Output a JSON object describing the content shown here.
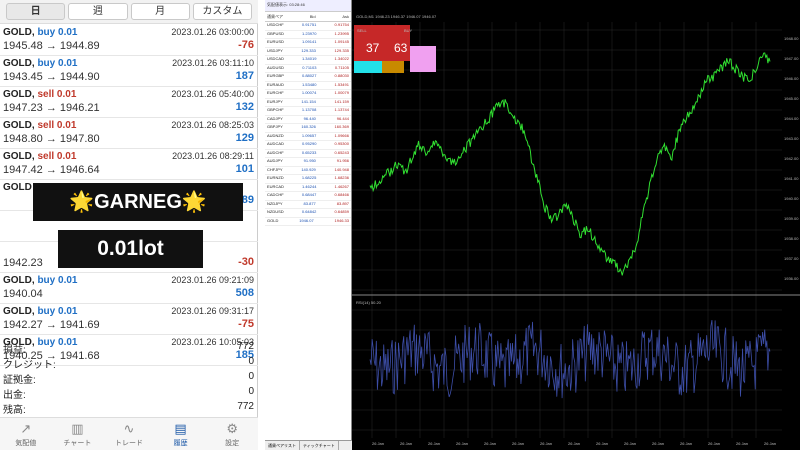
{
  "tabs": [
    "日",
    "週",
    "月",
    "カスタム"
  ],
  "trades": [
    {
      "symbol": "GOLD",
      "side": "buy",
      "lot": "0.01",
      "time": "2023.01.26 03:00:00",
      "from": "1945.48",
      "to": "1944.89",
      "profit": "-76"
    },
    {
      "symbol": "GOLD",
      "side": "buy",
      "lot": "0.01",
      "time": "2023.01.26 03:11:10",
      "from": "1943.45",
      "to": "1944.90",
      "profit": "187"
    },
    {
      "symbol": "GOLD",
      "side": "sell",
      "lot": "0.01",
      "time": "2023.01.26 05:40:00",
      "from": "1947.23",
      "to": "1946.21",
      "profit": "132"
    },
    {
      "symbol": "GOLD",
      "side": "sell",
      "lot": "0.01",
      "time": "2023.01.26 08:25:03",
      "from": "1948.80",
      "to": "1947.80",
      "profit": "129"
    },
    {
      "symbol": "GOLD",
      "side": "sell",
      "lot": "0.01",
      "time": "2023.01.26 08:29:11",
      "from": "1947.42",
      "to": "1946.64",
      "profit": "101"
    },
    {
      "symbol": "GOLD",
      "side": "",
      "lot": "",
      "time": "",
      "from": "",
      "to": "",
      "profit": "289"
    },
    {
      "symbol": "",
      "side": "",
      "lot": "",
      "time": "",
      "from": "",
      "to": "",
      "profit": ""
    },
    {
      "symbol": "",
      "side": "",
      "lot": "",
      "time": "",
      "from": "1942.23",
      "to": "",
      "profit": "-30"
    },
    {
      "symbol": "GOLD",
      "side": "buy",
      "lot": "0.01",
      "time": "2023.01.26 09:21:09",
      "from": "1940.04",
      "to": "",
      "profit": "508"
    },
    {
      "symbol": "GOLD",
      "side": "buy",
      "lot": "0.01",
      "time": "2023.01.26 09:31:17",
      "from": "1942.27",
      "to": "1941.69",
      "profit": "-75"
    },
    {
      "symbol": "GOLD",
      "side": "buy",
      "lot": "0.01",
      "time": "2023.01.26 10:05:03",
      "from": "1940.25",
      "to": "1941.68",
      "profit": "185"
    }
  ],
  "summary": [
    {
      "label": "損益:",
      "value": "772"
    },
    {
      "label": "クレジット:",
      "value": "0"
    },
    {
      "label": "証拠金:",
      "value": "0"
    },
    {
      "label": "出金:",
      "value": "0"
    },
    {
      "label": "残高:",
      "value": "772"
    }
  ],
  "nav": [
    {
      "label": "気配値",
      "icon": "↗"
    },
    {
      "label": "チャート",
      "icon": "▥"
    },
    {
      "label": "トレード",
      "icon": "∿"
    },
    {
      "label": "履歴",
      "icon": "▤"
    },
    {
      "label": "設定",
      "icon": "⚙"
    }
  ],
  "overlay": {
    "star": "🌟",
    "name": "GARNEG",
    "lot": "0.01lot"
  },
  "watch_rows": [
    {
      "sym": "USDCHF",
      "bid": "0.91751",
      "ask": "0.91754"
    },
    {
      "sym": "GBPUSD",
      "bid": "1.23970",
      "ask": "1.23995"
    },
    {
      "sym": "EURUSD",
      "bid": "1.09141",
      "ask": "1.09145"
    },
    {
      "sym": "USDJPY",
      "bid": "129.333",
      "ask": "129.335"
    },
    {
      "sym": "USDCAD",
      "bid": "1.34019",
      "ask": "1.34022"
    },
    {
      "sym": "AUDUSD",
      "bid": "0.71103",
      "ask": "0.71105"
    },
    {
      "sym": "EURGBP",
      "bid": "0.88027",
      "ask": "0.88030"
    },
    {
      "sym": "EURAUD",
      "bid": "1.53480",
      "ask": "1.53491"
    },
    {
      "sym": "EURCHF",
      "bid": "1.00074",
      "ask": "1.00079"
    },
    {
      "sym": "EURJPY",
      "bid": "141.154",
      "ask": "141.159"
    },
    {
      "sym": "GBPCHF",
      "bid": "1.13708",
      "ask": "1.13744"
    },
    {
      "sym": "CADJPY",
      "bid": "96.440",
      "ask": "96.444"
    },
    {
      "sym": "GBPJPY",
      "bid": "160.326",
      "ask": "160.369"
    },
    {
      "sym": "AUDNZD",
      "bid": "1.09657",
      "ask": "1.09666"
    },
    {
      "sym": "AUDCAD",
      "bid": "0.95290",
      "ask": "0.95300"
    },
    {
      "sym": "AUDCHF",
      "bid": "0.65233",
      "ask": "0.65243"
    },
    {
      "sym": "AUDJPY",
      "bid": "91.950",
      "ask": "91.956"
    },
    {
      "sym": "CHFJPY",
      "bid": "140.929",
      "ask": "140.948"
    },
    {
      "sym": "EURNZD",
      "bid": "1.68225",
      "ask": "1.68236"
    },
    {
      "sym": "EURCAD",
      "bid": "1.46244",
      "ask": "1.46267"
    },
    {
      "sym": "CADCHF",
      "bid": "0.68447",
      "ask": "0.68466"
    },
    {
      "sym": "NZDJPY",
      "bid": "83.877",
      "ask": "83.897"
    },
    {
      "sym": "NZDUSD",
      "bid": "0.64842",
      "ask": "0.64859"
    },
    {
      "sym": "GOLD",
      "bid": "1946.07",
      "ask": "1946.33"
    }
  ],
  "watch_title": "気配値表示: 03:28:46",
  "watch_col": {
    "sym": "通貨ペア",
    "bid": "Bid",
    "ask": "Ask"
  },
  "watch_tabs": [
    "通貨ペアリスト",
    "ティックチャート"
  ],
  "chart_title": "GOLD,M1 1946.23 1946.37 1946.07 1946.07",
  "trade_panel": {
    "sell": "SELL",
    "buy": "BUY",
    "lot": "0.01",
    "sell_big": "37",
    "buy_big": "63",
    "sell_small": "1946.",
    "buy_small": "1946."
  },
  "rsi_label": "RSI(14) 50.20",
  "colors": {
    "up": "#31e031",
    "down": "#31e031",
    "rsi": "#3d4ea8",
    "grid": "#2a2a2a"
  }
}
